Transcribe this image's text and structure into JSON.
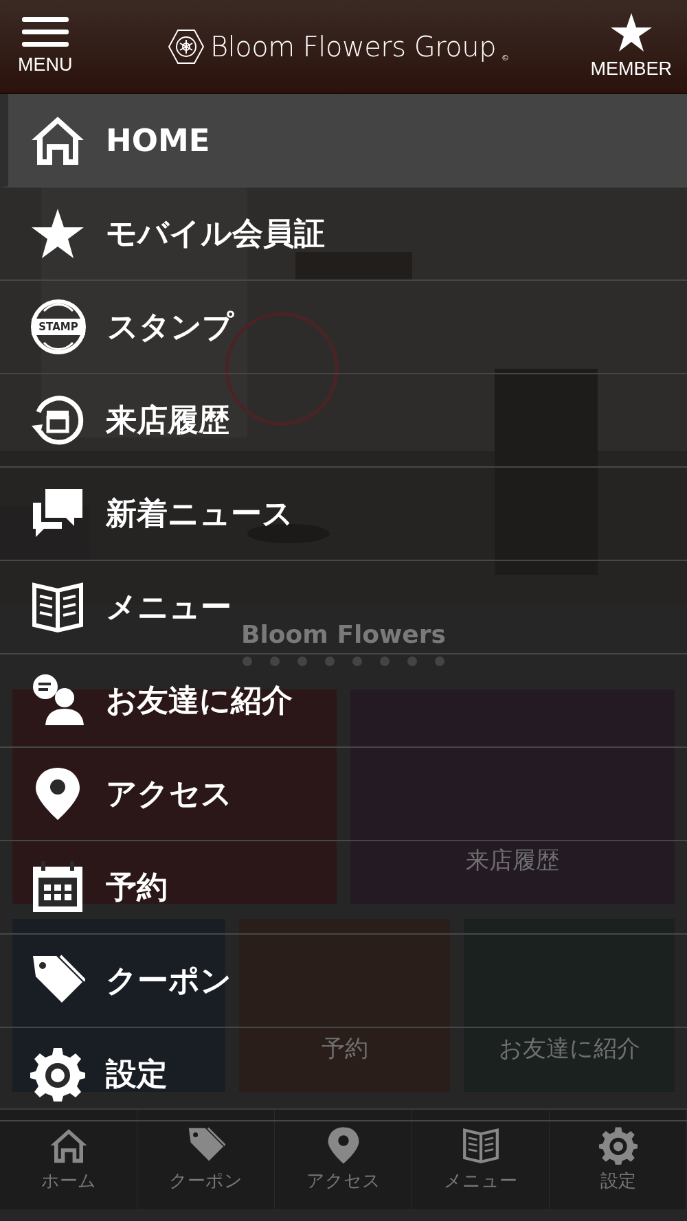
{
  "header": {
    "menu_label": "MENU",
    "brand": "Bloom Flowers Group",
    "brand_mark": "©",
    "member_label": "MEMBER"
  },
  "menu": [
    {
      "label": "HOME",
      "selected": true
    },
    {
      "label": "モバイル会員証",
      "selected": false
    },
    {
      "label": "スタンプ",
      "selected": false,
      "icon_text": "STAMP"
    },
    {
      "label": "来店履歴",
      "selected": false
    },
    {
      "label": "新着ニュース",
      "selected": false
    },
    {
      "label": "メニュー",
      "selected": false
    },
    {
      "label": "お友達に紹介",
      "selected": false
    },
    {
      "label": "アクセス",
      "selected": false
    },
    {
      "label": "予約",
      "selected": false
    },
    {
      "label": "クーポン",
      "selected": false
    },
    {
      "label": "設定",
      "selected": false
    }
  ],
  "background": {
    "caption": "Bloom Flowers",
    "tiles": [
      {
        "color": "#2b1718"
      },
      {
        "label": "来店履歴",
        "color": "#231a24"
      },
      {
        "color": "#191d24"
      },
      {
        "label": "予約",
        "color": "#2a1e1a"
      },
      {
        "label": "お友達に紹介",
        "color": "#1a211f"
      }
    ]
  },
  "tab_bar": [
    {
      "label": "ホーム"
    },
    {
      "label": "クーポン"
    },
    {
      "label": "アクセス"
    },
    {
      "label": "メニュー"
    },
    {
      "label": "設定"
    }
  ]
}
